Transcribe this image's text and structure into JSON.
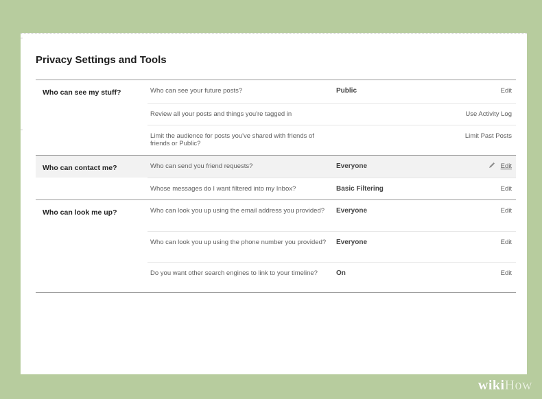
{
  "page": {
    "title": "Privacy Settings and Tools"
  },
  "sections": [
    {
      "label": "Who can see my stuff?",
      "rows": [
        {
          "question": "Who can see your future posts?",
          "value": "Public",
          "action": "Edit"
        },
        {
          "question": "Review all your posts and things you're tagged in",
          "value": "",
          "action": "Use Activity Log"
        },
        {
          "question": "Limit the audience for posts you've shared with friends of friends or Public?",
          "value": "",
          "action": "Limit Past Posts"
        }
      ]
    },
    {
      "label": "Who can contact me?",
      "rows": [
        {
          "question": "Who can send you friend requests?",
          "value": "Everyone",
          "action": "Edit",
          "icon": "pencil-icon"
        },
        {
          "question": "Whose messages do I want filtered into my Inbox?",
          "value": "Basic Filtering",
          "action": "Edit"
        }
      ]
    },
    {
      "label": "Who can look me up?",
      "rows": [
        {
          "question": "Who can look you up using the email address you provided?",
          "value": "Everyone",
          "action": "Edit"
        },
        {
          "question": "Who can look you up using the phone number you provided?",
          "value": "Everyone",
          "action": "Edit"
        },
        {
          "question": "Do you want other search engines to link to your timeline?",
          "value": "On",
          "action": "Edit"
        }
      ]
    }
  ],
  "watermark": {
    "part1": "wiki",
    "part2": "How"
  },
  "colors": {
    "background": "#b7cc9e",
    "panel": "#ffffff",
    "highlight_row": "#f2f2f2"
  }
}
